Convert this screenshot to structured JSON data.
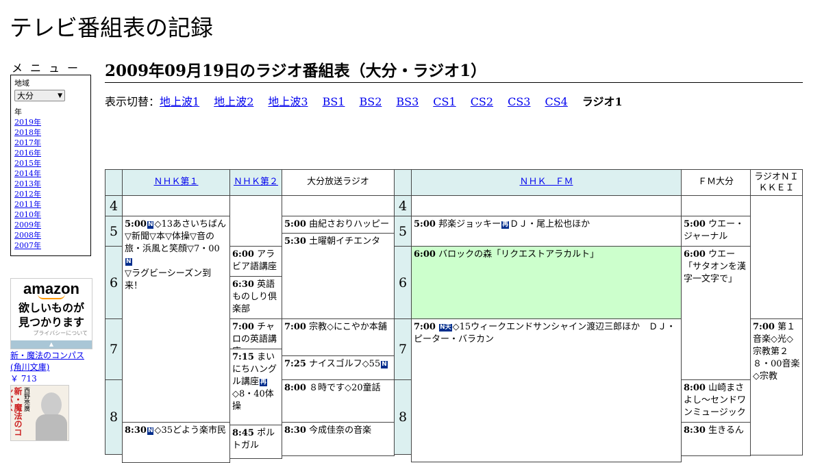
{
  "site_title": "テレビ番組表の記録",
  "menu": {
    "heading": "メニュー",
    "region_label": "地域",
    "region_value": "大分",
    "region_arrow": "▼",
    "year_label": "年",
    "years": [
      "2019年",
      "2018年",
      "2017年",
      "2016年",
      "2015年",
      "2014年",
      "2013年",
      "2012年",
      "2011年",
      "2010年",
      "2009年",
      "2008年",
      "2007年"
    ]
  },
  "ad": {
    "logo": "amazon",
    "line1": "欲しいものが",
    "line2": "見つかります",
    "privacy": "プライバシーについて",
    "bar": "▲"
  },
  "book": {
    "title": "新・魔法のコンパス",
    "publisher": "(角川文庫)",
    "price": "￥ 713",
    "cover_title": "新・魔法のコンパス",
    "cover_author": "西野亮廣"
  },
  "page_title": "2009年09月19日のラジオ番組表（大分・ラジオ1）",
  "switch": {
    "label": "表示切替：",
    "links": [
      "地上波1",
      "地上波2",
      "地上波3",
      "BS1",
      "BS2",
      "BS3",
      "CS1",
      "CS2",
      "CS3",
      "CS4"
    ],
    "current": "ラジオ1"
  },
  "channels": {
    "nhk1": "ＮＨＫ第１",
    "nhk2": "ＮＨＫ第２",
    "obs": "大分放送ラジオ",
    "nhkfm": "ＮＨＫ　ＦＭ",
    "fmoita": "ＦＭ大分",
    "nikkei": "ラジオＮＩＫＫＥＩ"
  },
  "hours": [
    "4",
    "5",
    "6",
    "7",
    "8"
  ],
  "programs": {
    "nhk1_0500": {
      "time": "5:00",
      "text": "◇13あさいちばん▽新聞▽本▽体操▽音の旅・浜風と笑顔▽7・00",
      "text2": "▽ラグビーシーズン到来！"
    },
    "nhk1_0830": {
      "time": "8:30",
      "text": "◇35どよう楽市民"
    },
    "nhk2_0600": {
      "time": "6:00",
      "text": "アラビア語講座"
    },
    "nhk2_0630": {
      "time": "6:30",
      "text": "英語ものしり倶楽部"
    },
    "nhk2_0700": {
      "time": "7:00",
      "text": "チャロの英語講座"
    },
    "nhk2_0715": {
      "time": "7:15",
      "text": "まいにちハングル講座",
      "text2": "◇8・40体操"
    },
    "nhk2_0845": {
      "time": "8:45",
      "text": "ポルトガル"
    },
    "obs_0500": {
      "time": "5:00",
      "text": "由紀さおりハッピー"
    },
    "obs_0530": {
      "time": "5:30",
      "text": "土曜朝イチエンタ"
    },
    "obs_0700": {
      "time": "7:00",
      "text": "宗教◇にこやか本舗"
    },
    "obs_0725": {
      "time": "7:25",
      "text": "ナイスゴルフ◇55"
    },
    "obs_0800": {
      "time": "8:00",
      "text": "８時です◇20童話"
    },
    "obs_0830": {
      "time": "8:30",
      "text": "今成佳奈の音楽"
    },
    "fm_0500": {
      "time": "5:00",
      "text": "邦楽ジョッキー",
      "text2": "ＤＪ・尾上松也ほか"
    },
    "fm_0600": {
      "time": "6:00",
      "text": "バロックの森「リクエストアラカルト」"
    },
    "fm_0700": {
      "time": "7:00",
      "text": "◇15ウィークエンドサンシャイン渡辺三郎ほか　ＤＪ・ピーター・バラカン"
    },
    "fmo_0500": {
      "time": "5:00",
      "text": "ウエー・ジャーナル"
    },
    "fmo_0600": {
      "time": "6:00",
      "text": "ウエー「サタオンを漢字一文字で」"
    },
    "fmo_0800": {
      "time": "8:00",
      "text": "山崎まさよし～センドワンミュージック"
    },
    "fmo_0830": {
      "time": "8:30",
      "text": "生きるん"
    },
    "nk_0700": {
      "time": "7:00",
      "text": "第１音楽◇光◇宗教第２８・00音楽◇宗教"
    }
  },
  "badges": {
    "news": "N",
    "re": "再",
    "stereo": "N天"
  }
}
